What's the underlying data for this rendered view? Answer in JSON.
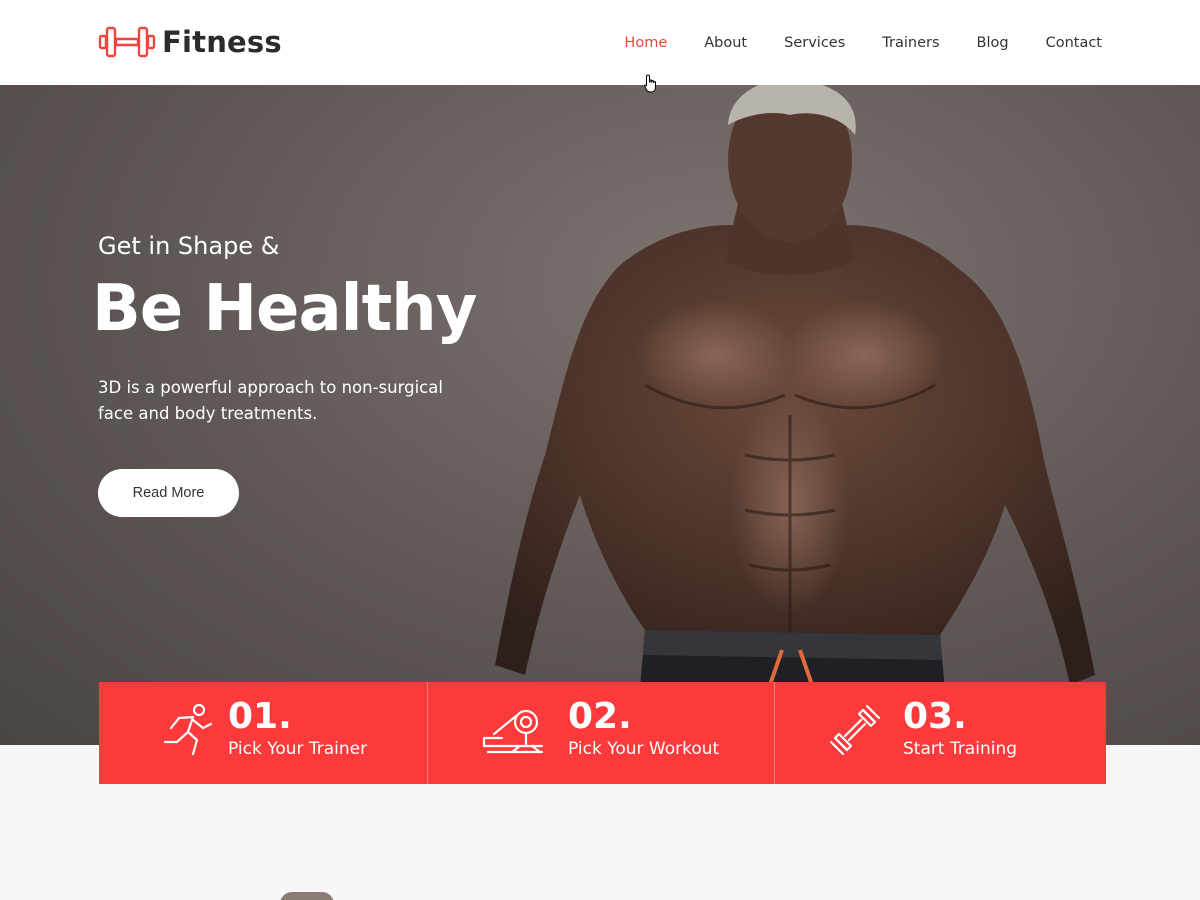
{
  "brand": {
    "name": "Fitness",
    "accent": "#f0453f"
  },
  "nav": {
    "items": [
      {
        "label": "Home",
        "active": true
      },
      {
        "label": "About",
        "active": false
      },
      {
        "label": "Services",
        "active": false
      },
      {
        "label": "Trainers",
        "active": false
      },
      {
        "label": "Blog",
        "active": false
      },
      {
        "label": "Contact",
        "active": false
      }
    ]
  },
  "hero": {
    "subtitle": "Get in Shape &",
    "title": "Be Healthy",
    "description": "3D is a powerful approach to non-surgical face and body treatments.",
    "button_label": "Read More"
  },
  "steps": [
    {
      "number": "01.",
      "label": "Pick Your Trainer",
      "icon": "runner-icon"
    },
    {
      "number": "02.",
      "label": "Pick Your Workout",
      "icon": "exercise-machine-icon"
    },
    {
      "number": "03.",
      "label": "Start Training",
      "icon": "dumbbell-icon"
    }
  ],
  "colors": {
    "steps_bg": "#fc3a3b",
    "header_bg": "#ffffff"
  }
}
